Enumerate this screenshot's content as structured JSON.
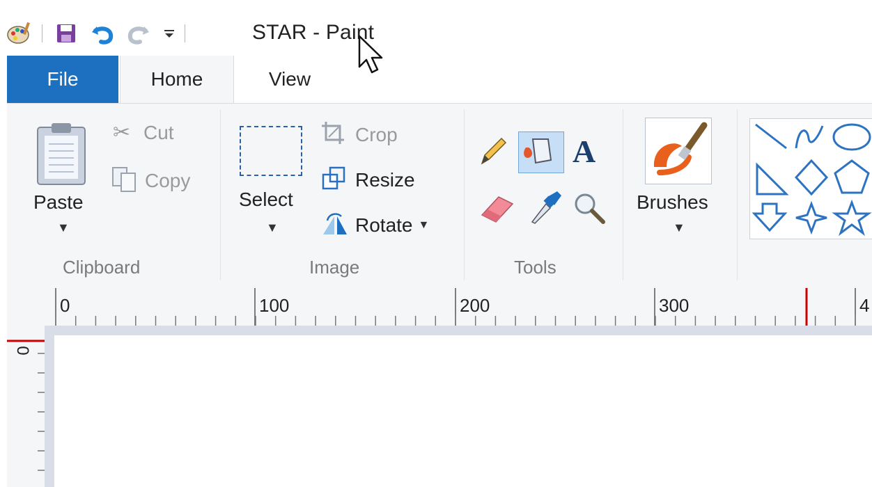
{
  "window": {
    "title": "STAR - Paint"
  },
  "quick_access": [
    {
      "name": "paint-app-icon"
    },
    {
      "name": "save-icon"
    },
    {
      "name": "undo-icon"
    },
    {
      "name": "redo-icon"
    },
    {
      "name": "customize-qat-icon"
    }
  ],
  "tabs": {
    "file": "File",
    "home": "Home",
    "view": "View"
  },
  "clipboard": {
    "paste": "Paste",
    "cut": "Cut",
    "copy": "Copy",
    "group": "Clipboard"
  },
  "image": {
    "select": "Select",
    "crop": "Crop",
    "resize": "Resize",
    "rotate": "Rotate",
    "group": "Image"
  },
  "tools": {
    "group": "Tools",
    "icons": [
      "pencil-icon",
      "fill-icon",
      "text-icon",
      "eraser-icon",
      "color-picker-icon",
      "magnifier-icon"
    ]
  },
  "brushes": {
    "label": "Brushes"
  },
  "shapes": {
    "icons": [
      "line-icon",
      "curve-icon",
      "oval-icon",
      "right-triangle-icon",
      "diamond-icon",
      "pentagon-icon",
      "down-arrow-icon",
      "four-point-star-icon",
      "five-point-star-icon"
    ]
  },
  "ruler": {
    "ticks": [
      "0",
      "100",
      "200",
      "300",
      "4"
    ],
    "vtick": "0"
  },
  "colors": {
    "file_tab": "#1d6fc0",
    "ribbon_bg": "#f5f6f7",
    "canvas_bg": "#d8dde8",
    "ruler_marker": "#cc0000"
  }
}
